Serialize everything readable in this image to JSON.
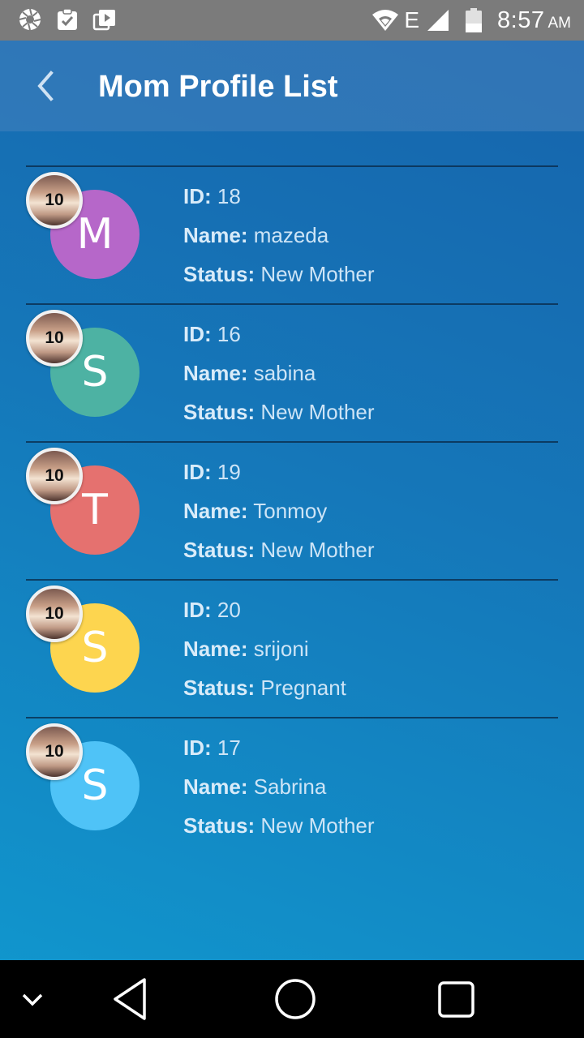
{
  "status_bar": {
    "time": "8:57",
    "ampm": "AM",
    "network_type": "E",
    "left_icons": [
      "camera-aperture-icon",
      "clipboard-check-icon",
      "media-library-icon"
    ],
    "right_icons": [
      "wifi-icon",
      "signal-icon",
      "battery-icon"
    ]
  },
  "app_bar": {
    "title": "Mom Profile List",
    "back_icon": "chevron-left-icon"
  },
  "labels": {
    "id": "ID:",
    "name": "Name:",
    "status": "Status:"
  },
  "profiles": [
    {
      "badge": "10",
      "initial": "M",
      "color": "#b667c9",
      "id": "18",
      "name": "mazeda",
      "status": "New Mother"
    },
    {
      "badge": "10",
      "initial": "S",
      "color": "#4db2a3",
      "id": "16",
      "name": "sabina",
      "status": "New Mother"
    },
    {
      "badge": "10",
      "initial": "T",
      "color": "#e5716f",
      "id": "19",
      "name": "Tonmoy",
      "status": "New Mother"
    },
    {
      "badge": "10",
      "initial": "S",
      "color": "#fdd54f",
      "id": "20",
      "name": "srijoni",
      "status": "Pregnant"
    },
    {
      "badge": "10",
      "initial": "S",
      "color": "#4fc3f7",
      "id": "17",
      "name": "Sabrina",
      "status": "New Mother"
    }
  ],
  "nav_bar": {
    "icons": [
      "chevron-down-icon",
      "back-triangle-icon",
      "home-circle-icon",
      "recents-square-icon"
    ]
  }
}
